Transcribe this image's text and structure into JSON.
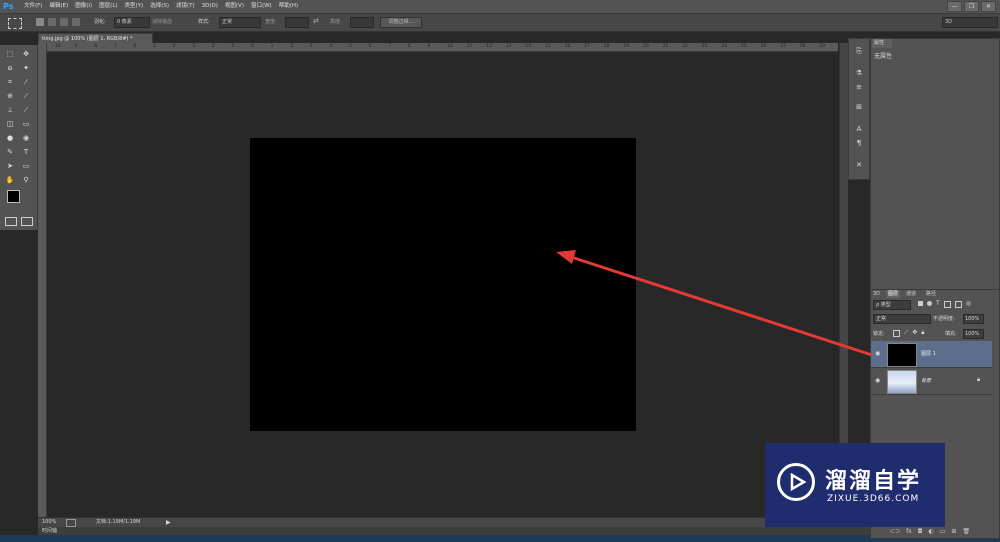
{
  "app": {
    "logo": "Ps"
  },
  "menu": [
    "文件(F)",
    "编辑(E)",
    "图像(I)",
    "图层(L)",
    "类型(Y)",
    "选择(S)",
    "滤镜(T)",
    "3D(D)",
    "视图(V)",
    "窗口(W)",
    "帮助(H)"
  ],
  "window_buttons": [
    "—",
    "❐",
    "✕"
  ],
  "options_bar": {
    "feather_label": "羽化:",
    "feather_value": "0 像素",
    "antialias_label": "消除锯齿",
    "style_label": "样式:",
    "style_value": "正常",
    "width_label": "宽度:",
    "height_label": "高度:",
    "refine_button": "调整边缘...",
    "workspace": "3D"
  },
  "document": {
    "tab_title": "timg.jpg @ 100% (图层 1, RGB/8#) *",
    "canvas_color": "#000000"
  },
  "ruler_top_ticks": [
    "10",
    "9",
    "8",
    "7",
    "6",
    "5",
    "4",
    "3",
    "2",
    "1",
    "0",
    "1",
    "2",
    "3",
    "4",
    "5",
    "6",
    "7",
    "8",
    "9",
    "10",
    "11",
    "12",
    "13",
    "14",
    "15",
    "16",
    "17",
    "18",
    "19",
    "20",
    "21",
    "22",
    "23",
    "24",
    "25",
    "26",
    "27",
    "28",
    "29"
  ],
  "status": {
    "zoom": "100%",
    "doc_info": "文档:1.19M/1.19M"
  },
  "timeline_label": "时间轴",
  "properties": {
    "tab_label": "属性",
    "content": "无属性"
  },
  "layers_panel": {
    "tabs": [
      "3D",
      "图层",
      "通道",
      "路径"
    ],
    "filter_label": "ρ 类型",
    "blend_mode": "正常",
    "opacity_label": "不透明度:",
    "opacity_value": "100%",
    "lock_label": "锁定:",
    "fill_label": "填充:",
    "fill_value": "100%",
    "layers": [
      {
        "name": "图层 1",
        "selected": true
      },
      {
        "name": "背景",
        "selected": false
      }
    ]
  },
  "watermark": {
    "title": "溜溜自学",
    "subtitle": "ZIXUE.3D66.COM"
  },
  "colors": {
    "accent_arrow": "#e53935",
    "selected_layer": "#5c6e8c",
    "watermark_bg": "#1f2d6e"
  }
}
